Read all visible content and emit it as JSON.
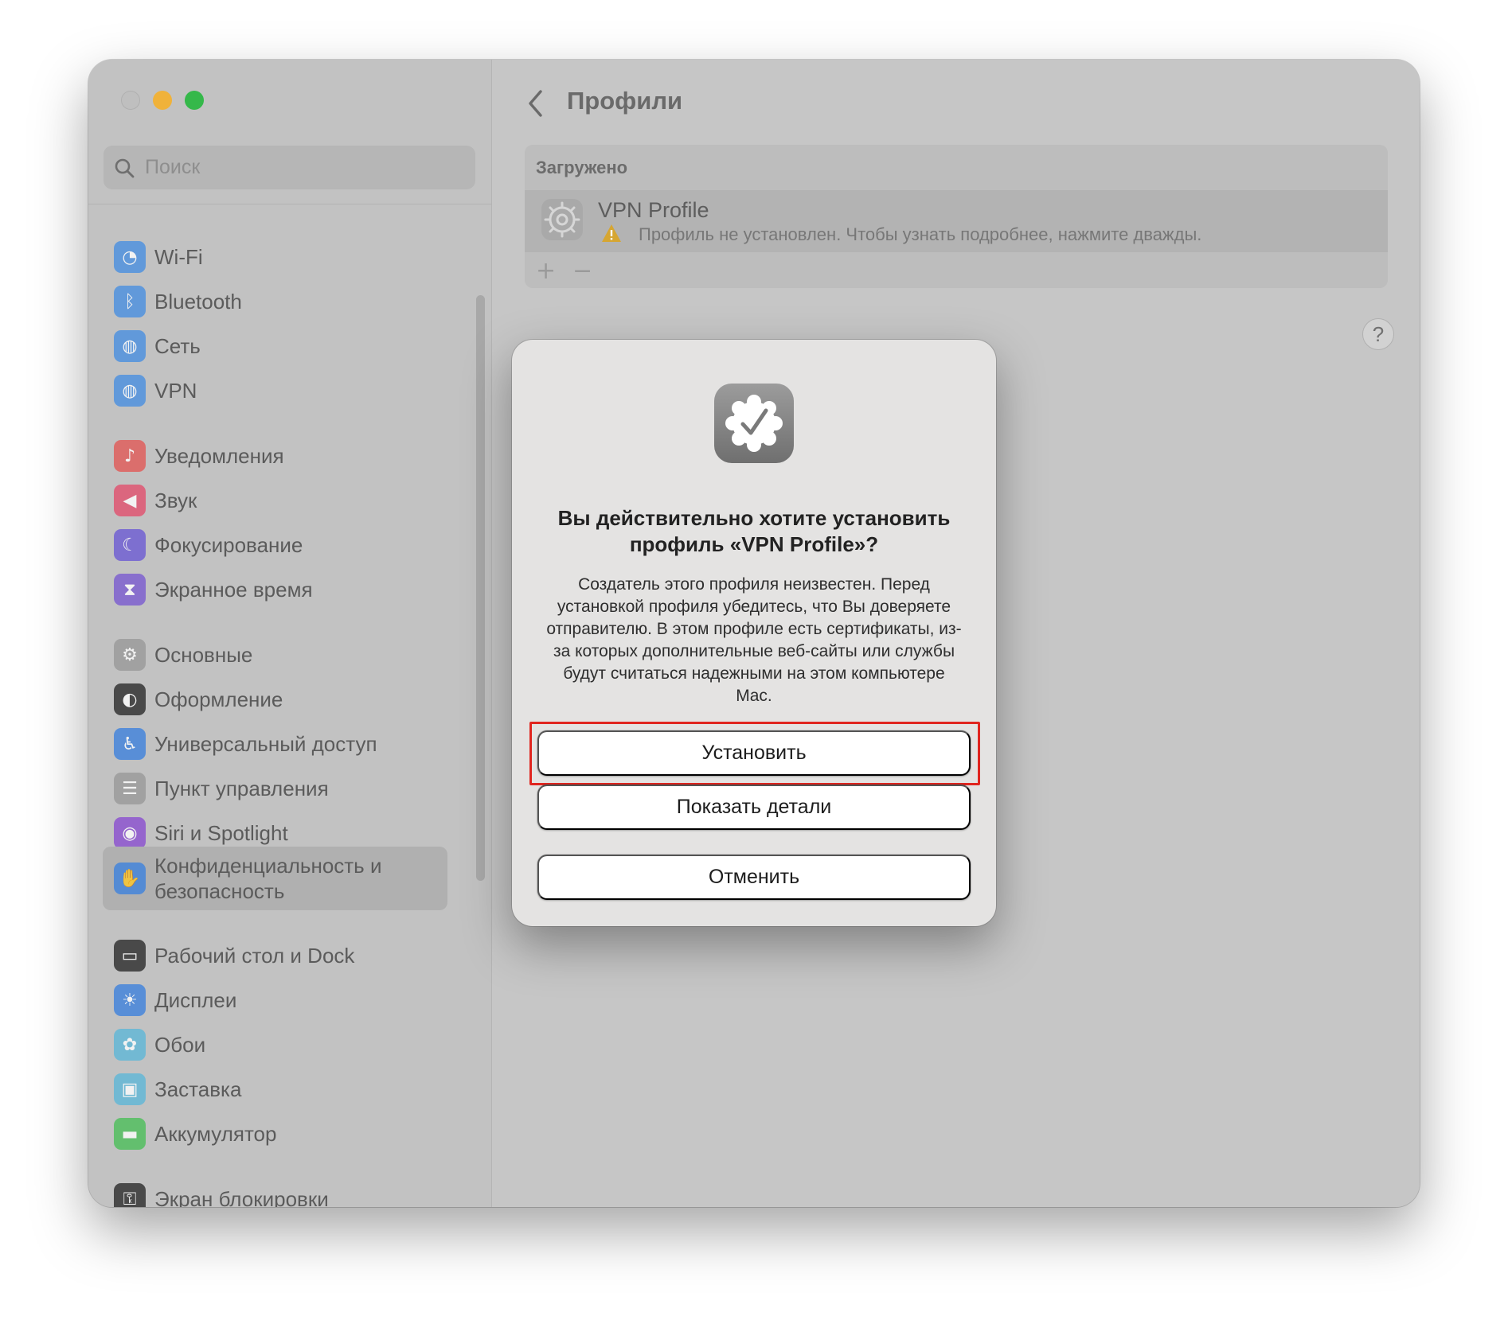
{
  "window": {
    "traffic_lights": [
      "close",
      "minimize",
      "maximize"
    ]
  },
  "sidebar": {
    "search_placeholder": "Поиск",
    "items": [
      {
        "label": "Wi-Fi",
        "icon": "wifi-icon",
        "color": "#4a8fe0",
        "glyph": "◔"
      },
      {
        "label": "Bluetooth",
        "icon": "bluetooth-icon",
        "color": "#4a8fe0",
        "glyph": "ᛒ"
      },
      {
        "label": "Сеть",
        "icon": "globe-icon",
        "color": "#4a8fe0",
        "glyph": "◍"
      },
      {
        "label": "VPN",
        "icon": "vpn-globe-icon",
        "color": "#4a8fe0",
        "glyph": "◍"
      },
      {
        "label": "Уведомления",
        "icon": "bell-icon",
        "color": "#e25a57",
        "glyph": "♪"
      },
      {
        "label": "Звук",
        "icon": "speaker-icon",
        "color": "#e2506e",
        "glyph": "◀"
      },
      {
        "label": "Фокусирование",
        "icon": "moon-icon",
        "color": "#6c5bd4",
        "glyph": "☾"
      },
      {
        "label": "Экранное время",
        "icon": "hourglass-icon",
        "color": "#7a5bd0",
        "glyph": "⧗"
      },
      {
        "label": "Основные",
        "icon": "gear-icon",
        "color": "#9a9a9a",
        "glyph": "⚙"
      },
      {
        "label": "Оформление",
        "icon": "appearance-icon",
        "color": "#2b2b2b",
        "glyph": "◐"
      },
      {
        "label": "Универсальный доступ",
        "icon": "accessibility-icon",
        "color": "#3e82dd",
        "glyph": "♿"
      },
      {
        "label": "Пункт управления",
        "icon": "control-center-icon",
        "color": "#9a9a9a",
        "glyph": "☰"
      },
      {
        "label": "Siri и Spotlight",
        "icon": "siri-icon",
        "color": "#8a4fd0",
        "glyph": "◉"
      },
      {
        "label": "Конфиденциальность и безопасность",
        "icon": "hand-icon",
        "color": "#3e82dd",
        "glyph": "✋"
      },
      {
        "label": "Рабочий стол и Dock",
        "icon": "dock-icon",
        "color": "#2b2b2b",
        "glyph": "▭"
      },
      {
        "label": "Дисплеи",
        "icon": "sun-icon",
        "color": "#3e82dd",
        "glyph": "☀"
      },
      {
        "label": "Обои",
        "icon": "flower-icon",
        "color": "#5fb8d8",
        "glyph": "✿"
      },
      {
        "label": "Заставка",
        "icon": "screensaver-icon",
        "color": "#5fb8d8",
        "glyph": "▣"
      },
      {
        "label": "Аккумулятор",
        "icon": "battery-icon",
        "color": "#4cbf5a",
        "glyph": "▬"
      },
      {
        "label": "Экран блокировки",
        "icon": "lock-icon",
        "color": "#2b2b2b",
        "glyph": "⚿"
      }
    ],
    "selected_index": 13
  },
  "main": {
    "title": "Профили",
    "section_header": "Загружено",
    "profile": {
      "name": "VPN Profile",
      "status": "Профиль не установлен. Чтобы узнать подробнее, нажмите дважды."
    },
    "toolbar": {
      "add": "+",
      "remove": "−"
    },
    "help": "?"
  },
  "dialog": {
    "title": "Вы действительно хотите установить профиль «VPN Profile»?",
    "message": "Создатель этого профиля неизвестен. Перед установкой профиля убедитесь, что Вы доверяете отправителю. В этом профиле есть сертификаты, из-за которых дополнительные веб-сайты или службы будут считаться надежными на этом компьютере Mac.",
    "install_label": "Установить",
    "details_label": "Показать детали",
    "cancel_label": "Отменить",
    "highlight_color": "#e0251f"
  }
}
